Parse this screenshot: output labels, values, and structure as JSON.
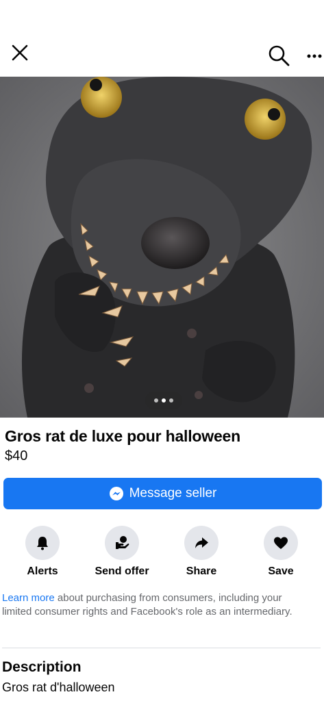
{
  "header": {
    "close_icon": "close-icon",
    "search_icon": "search-icon",
    "more_icon": "more-horizontal-icon"
  },
  "carousel": {
    "image_alt": "Black latex rat mask with yellow eyes and sharp teeth",
    "page_count": 3,
    "current_page": 2
  },
  "listing": {
    "title": "Gros rat de luxe pour halloween",
    "price": "$40"
  },
  "message_button": {
    "label": "Message seller",
    "icon": "messenger-icon",
    "color": "#1877f2"
  },
  "actions": [
    {
      "label": "Alerts",
      "icon": "bell-icon"
    },
    {
      "label": "Send offer",
      "icon": "send-offer-icon"
    },
    {
      "label": "Share",
      "icon": "share-arrow-icon"
    },
    {
      "label": "Save",
      "icon": "heart-icon"
    }
  ],
  "info": {
    "link_text": "Learn more",
    "text": " about purchasing from consumers, including your limited consumer rights and Facebook's role as an intermediary."
  },
  "description": {
    "heading": "Description",
    "text": "Gros rat d'halloween"
  }
}
